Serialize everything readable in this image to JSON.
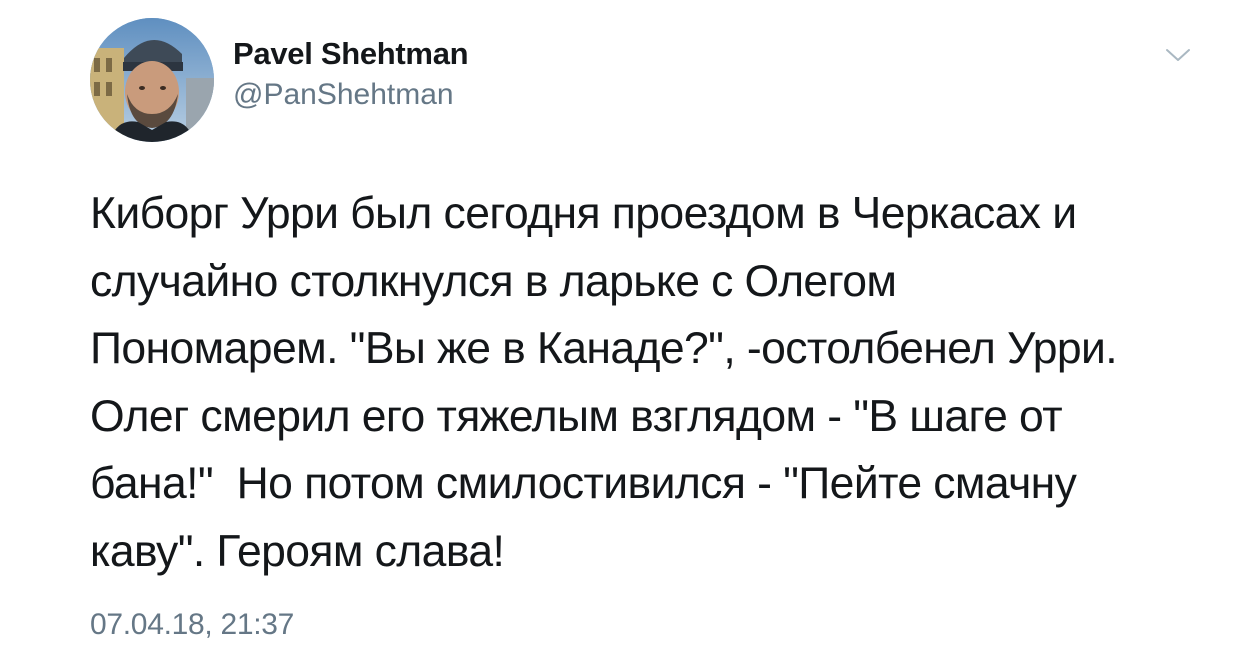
{
  "tweet": {
    "author": {
      "display_name": "Pavel Shehtman",
      "handle": "@PanShehtman"
    },
    "menu_icon": "chevron-down-icon",
    "text_lines": [
      "Киборг Урри был сегодня проездом в Черкасах и",
      "случайно столкнулся в ларьке с Олегом",
      "Пономарем. \"Вы же в Канаде?\", -остолбенел Урри.",
      "Олег смерил его тяжелым взглядом - \"В шаге от",
      "бана!\"  Но потом смилостивился - \"Пейте смачну",
      "каву\". Героям слава!"
    ],
    "timestamp": "07.04.18, 21:37"
  },
  "colors": {
    "text_primary": "#14171a",
    "text_secondary": "#657786",
    "chevron": "#aab8c2",
    "background": "#ffffff"
  }
}
